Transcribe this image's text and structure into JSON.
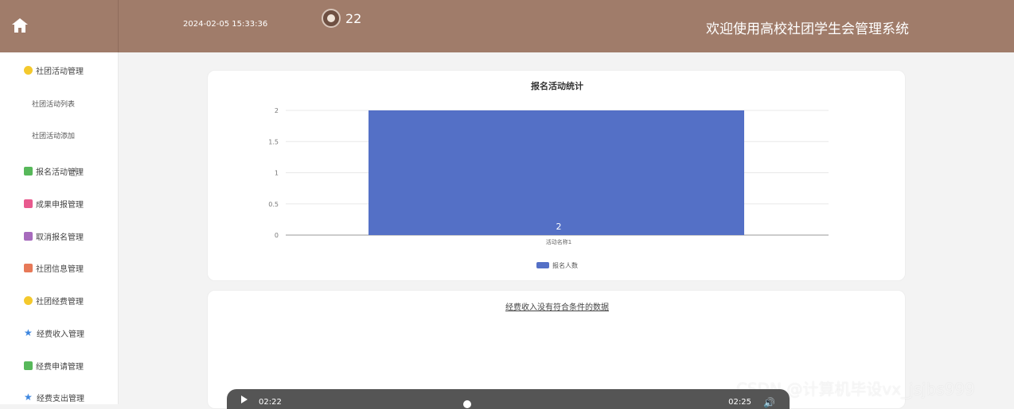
{
  "header": {
    "datetime": "2024-02-05 15:33:36",
    "user_count": "22",
    "welcome": "欢迎使用高校社团学生会管理系统"
  },
  "sidebar": {
    "items": [
      {
        "label": "社团活动管理",
        "icon": "yellow-circle-icon",
        "color": "#f4c92d"
      },
      {
        "label": "报名活动管理",
        "icon": "green-message-icon",
        "color": "#57b85a"
      },
      {
        "label": "成果申报管理",
        "icon": "pink-document-icon",
        "color": "#e85a8e"
      },
      {
        "label": "取消报名管理",
        "icon": "purple-archive-icon",
        "color": "#a76bbd"
      },
      {
        "label": "社团信息管理",
        "icon": "orange-grid-icon",
        "color": "#e77958"
      },
      {
        "label": "社团经费管理",
        "icon": "yellow-circle-icon",
        "color": "#f4c92d"
      },
      {
        "label": "经费收入管理",
        "icon": "blue-star-icon",
        "color": "#3d86df"
      },
      {
        "label": "经费申请管理",
        "icon": "green-message-icon",
        "color": "#57b85a"
      },
      {
        "label": "经费支出管理",
        "icon": "blue-star-icon",
        "color": "#3d86df"
      }
    ],
    "submenu": [
      {
        "label": "社团活动列表"
      },
      {
        "label": "社团活动添加"
      }
    ]
  },
  "empty_message": "经费收入没有符合条件的数据",
  "video": {
    "current_time": "02:22",
    "duration": "02:25"
  },
  "watermark": "CSDN @计算机毕设vx_jsjbs999",
  "chart_data": {
    "type": "bar",
    "title": "报名活动统计",
    "categories": [
      "活动名称1"
    ],
    "series": [
      {
        "name": "报名人数",
        "values": [
          2
        ]
      }
    ],
    "ylim": [
      0,
      2
    ],
    "yticks": [
      "0",
      "0.5",
      "1",
      "1.5",
      "2"
    ],
    "data_labels": [
      "2"
    ],
    "color": "#5470c6",
    "legend": "bottom-center",
    "grid": true
  }
}
